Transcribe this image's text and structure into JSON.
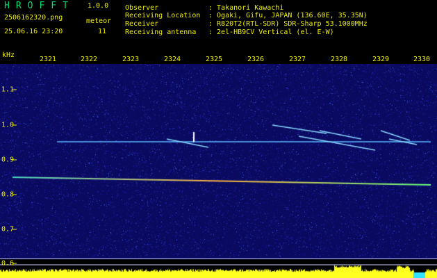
{
  "header": {
    "app_title": "HROFFT",
    "app_version": "1.0.0",
    "file_name": "2506162320.png",
    "date_time": "25.06.16 23:20",
    "meteor_label": "meteor",
    "meteor_count": "11",
    "info": [
      {
        "key": "Observer",
        "value": ": Takanori Kawachi"
      },
      {
        "key": "Receiving Location",
        "value": ": Ogaki, Gifu, JAPAN (136.60E, 35.35N)"
      },
      {
        "key": "Receiver",
        "value": ": R820T2(RTL-SDR) SDR-Sharp 53.1000MHz"
      },
      {
        "key": "Receiving antenna",
        "value": ": 2el-HB9CV Vertical (el. E-W)"
      }
    ]
  },
  "axis": {
    "y_unit": "kHz",
    "time_ticks": [
      "2321",
      "2322",
      "2323",
      "2324",
      "2325",
      "2326",
      "2327",
      "2328",
      "2329",
      "2330"
    ],
    "freq_ticks": [
      "1.1",
      "1.0",
      "0.9",
      "0.8",
      "0.7",
      "0.6"
    ]
  },
  "colors": {
    "background": "#0a0a60",
    "text": "#f0f000",
    "title": "#00e070",
    "noise_floor": "#ffff20"
  }
}
